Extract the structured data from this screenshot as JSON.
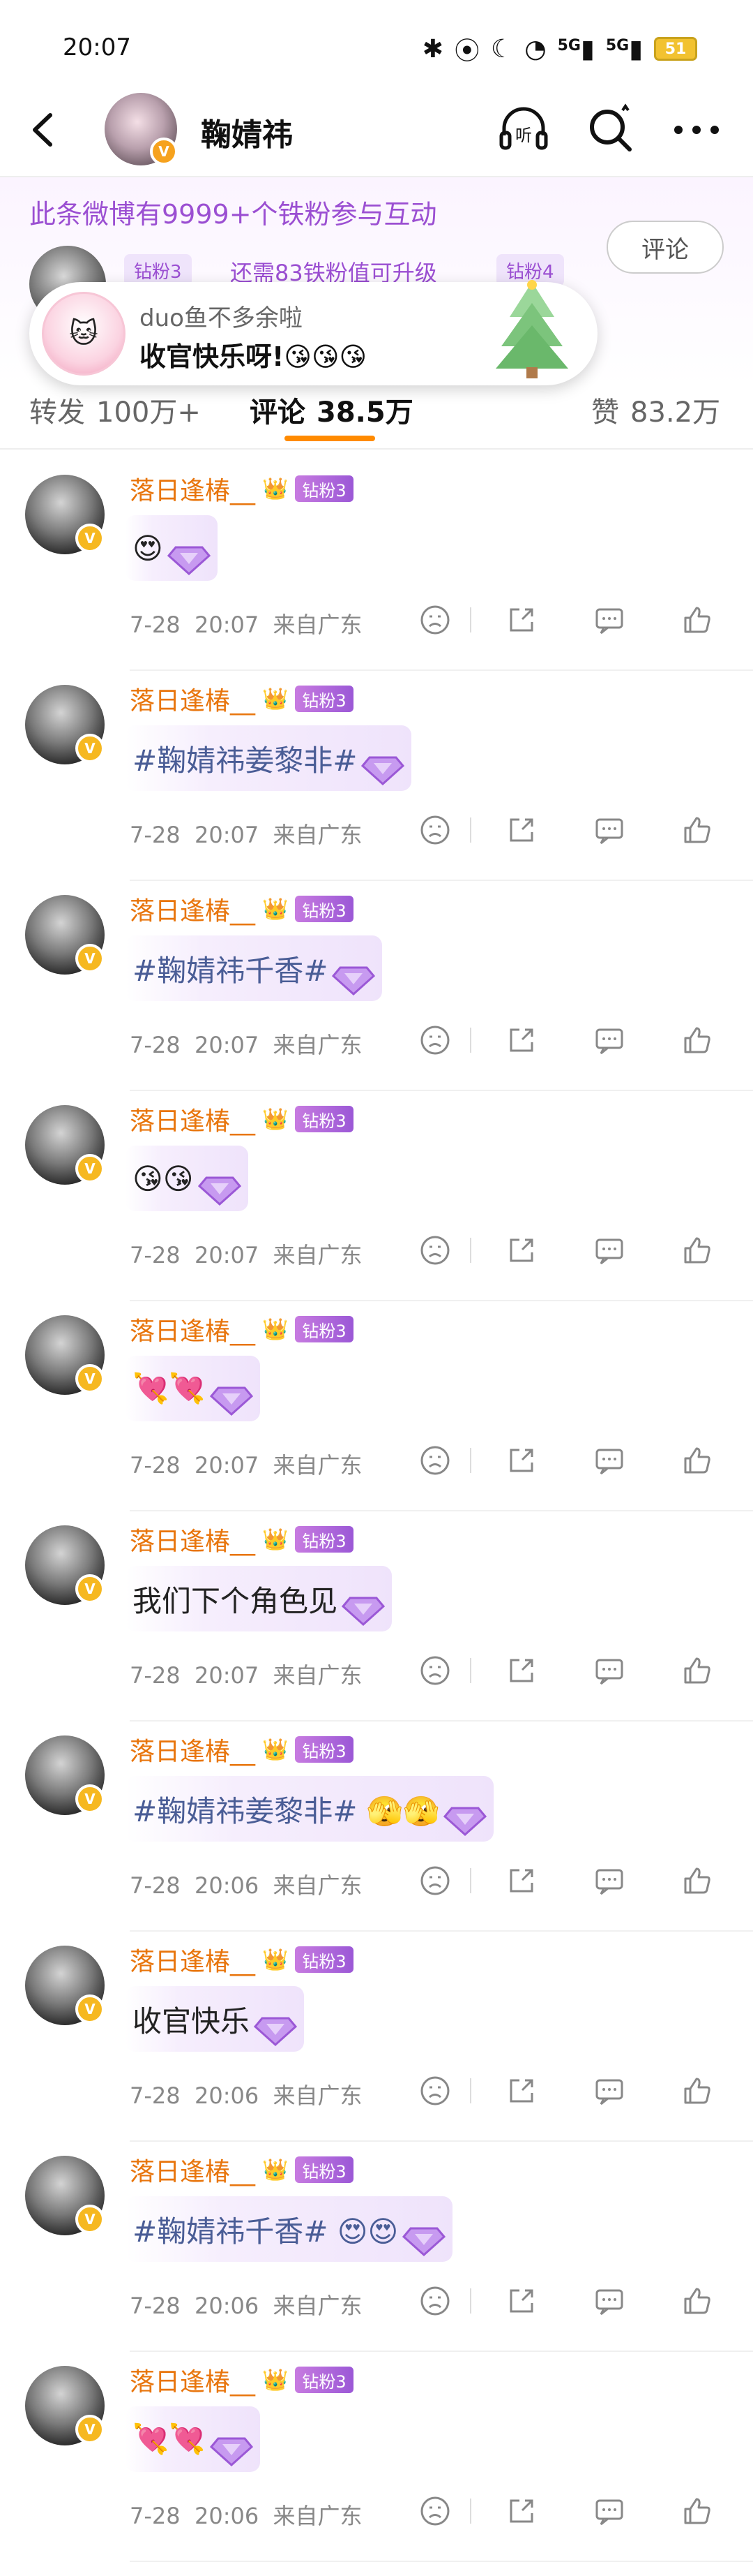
{
  "status_bar": {
    "time": "20:07",
    "signal_1": "5G",
    "signal_2": "5G",
    "battery": "51"
  },
  "nav": {
    "title": "鞠婧祎"
  },
  "fan_banner": {
    "text": "此条微博有9999+个铁粉参与互动",
    "current_badge": "钻粉3",
    "need_text": "还需83铁粉值可升级",
    "next_badge": "钻粉4",
    "comment_button": "评论"
  },
  "popup": {
    "name": "duo鱼不多余啦",
    "message": "收官快乐呀!😘😘😘"
  },
  "tabs": [
    {
      "label": "转发",
      "count": "100万+"
    },
    {
      "label": "评论",
      "count": "38.5万"
    },
    {
      "label": "赞",
      "count": "83.2万"
    }
  ],
  "comments": [
    {
      "name": "落日逢椿__",
      "badge": "钻粉3",
      "text": "😍",
      "date": "7-28",
      "time": "20:07",
      "location": "来自广东",
      "is_tag": false
    },
    {
      "name": "落日逢椿__",
      "badge": "钻粉3",
      "text": "#鞠婧祎姜黎非#",
      "date": "7-28",
      "time": "20:07",
      "location": "来自广东",
      "is_tag": true
    },
    {
      "name": "落日逢椿__",
      "badge": "钻粉3",
      "text": "#鞠婧祎千香#",
      "date": "7-28",
      "time": "20:07",
      "location": "来自广东",
      "is_tag": true
    },
    {
      "name": "落日逢椿__",
      "badge": "钻粉3",
      "text": "😘😘",
      "date": "7-28",
      "time": "20:07",
      "location": "来自广东",
      "is_tag": false
    },
    {
      "name": "落日逢椿__",
      "badge": "钻粉3",
      "text": "💘💘",
      "date": "7-28",
      "time": "20:07",
      "location": "来自广东",
      "is_tag": false
    },
    {
      "name": "落日逢椿__",
      "badge": "钻粉3",
      "text": "我们下个角色见",
      "date": "7-28",
      "time": "20:07",
      "location": "来自广东",
      "is_tag": false
    },
    {
      "name": "落日逢椿__",
      "badge": "钻粉3",
      "text": "#鞠婧祎姜黎非# 🫣🫣",
      "date": "7-28",
      "time": "20:06",
      "location": "来自广东",
      "is_tag": true
    },
    {
      "name": "落日逢椿__",
      "badge": "钻粉3",
      "text": "收官快乐",
      "date": "7-28",
      "time": "20:06",
      "location": "来自广东",
      "is_tag": false
    },
    {
      "name": "落日逢椿__",
      "badge": "钻粉3",
      "text": "#鞠婧祎千香# 😍😍",
      "date": "7-28",
      "time": "20:06",
      "location": "来自广东",
      "is_tag": true
    },
    {
      "name": "落日逢椿__",
      "badge": "钻粉3",
      "text": "💘💘",
      "date": "7-28",
      "time": "20:06",
      "location": "来自广东",
      "is_tag": false
    }
  ],
  "icons": {
    "back": "back-arrow-icon",
    "listen": "headphones-listen-icon",
    "search": "search-icon",
    "more": "more-dots-icon",
    "dislike": "dislike-face-icon",
    "share": "share-icon",
    "reply": "comment-icon",
    "like": "thumbs-up-icon"
  },
  "colors": {
    "accent_orange": "#ff8a00",
    "name_orange": "#e8750c",
    "fan_purple": "#9b4fd2",
    "tag_blue": "#4a5d96"
  }
}
